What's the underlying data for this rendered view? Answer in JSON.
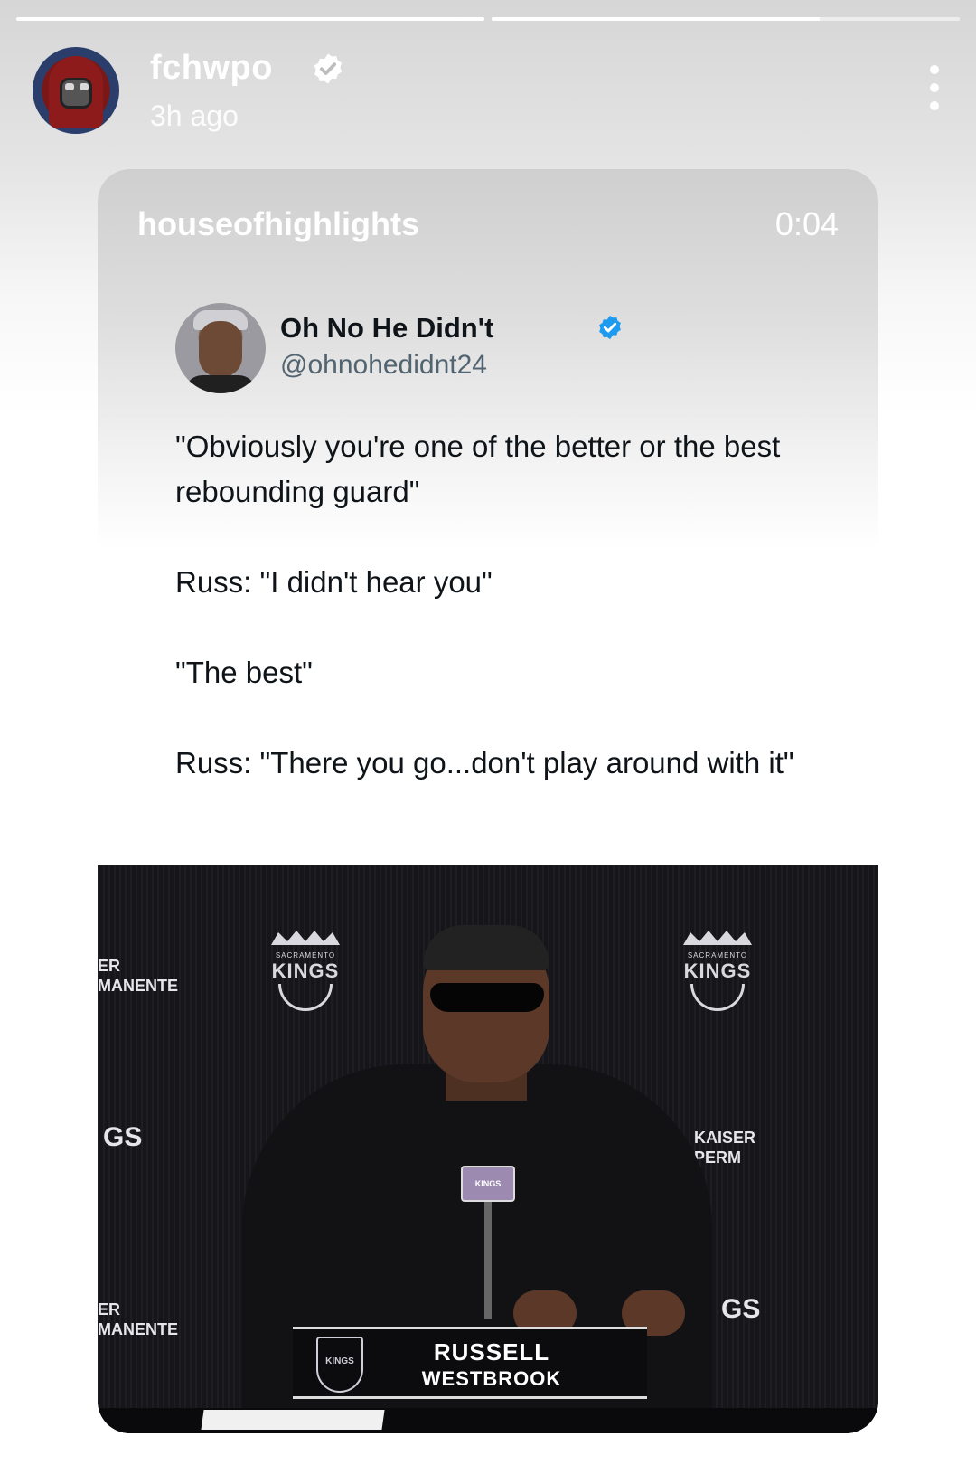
{
  "story": {
    "progress": [
      1.0,
      0.7
    ],
    "username": "fchwpo",
    "verified_icon": "verified-badge-icon",
    "time_ago": "3h ago",
    "more_icon": "more-vertical-icon"
  },
  "card": {
    "source_handle": "houseofhighlights",
    "timer": "0:04"
  },
  "tweet": {
    "display_name": "Oh No He Didn't",
    "handle": "@ohnohedidnt24",
    "paragraphs": [
      "\"Obviously you're one of the better or the best rebounding guard\"",
      "Russ: \"I didn't hear you\"",
      "\"The best\"",
      "Russ: \"There you go...don't play around with it\""
    ]
  },
  "video": {
    "backdrop_logo_word": "KINGS",
    "backdrop_logo_small": "SACRAMENTO",
    "sponsor_fragments": [
      "ER",
      "MANENTE",
      "KAISER",
      "PERM",
      "GS"
    ],
    "lower_third": {
      "first_name": "RUSSELL",
      "last_name": "WESTBROOK",
      "logo_word": "KINGS"
    }
  },
  "colors": {
    "verified_blue": "#1d9bf0",
    "text_primary": "#0f1419",
    "text_secondary": "#536471"
  }
}
